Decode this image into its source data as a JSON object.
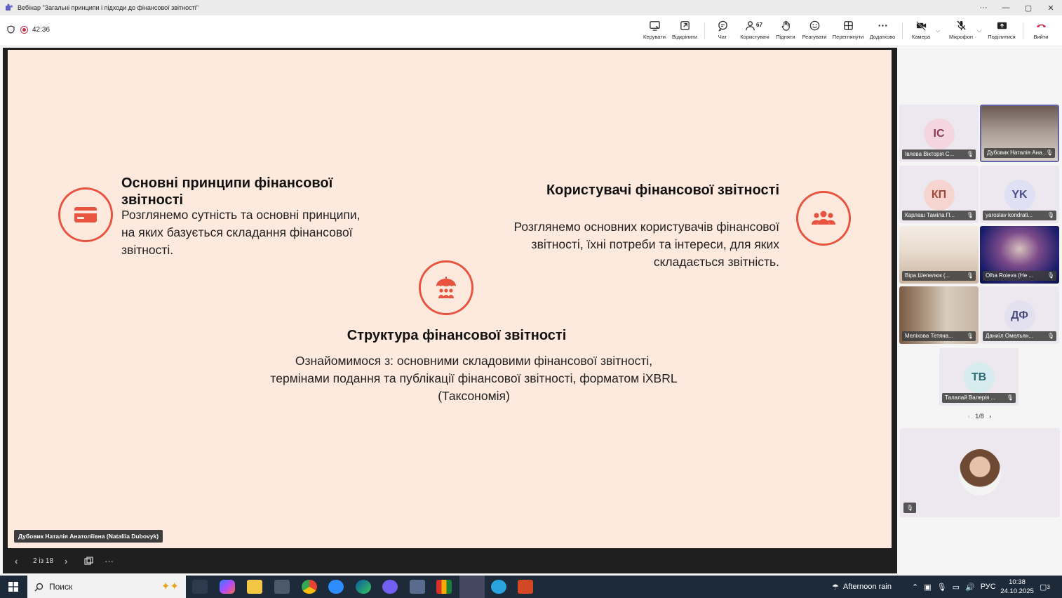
{
  "window": {
    "title": "Вебінар \"Загальні принципи і підходи до фінансової звітності\"",
    "controls": [
      "···",
      "—",
      "▢",
      "✕"
    ]
  },
  "meeting": {
    "timer": "42:36",
    "toolbar": {
      "manage": "Керувати",
      "unpin": "Відкріпити",
      "chat": "Чат",
      "users": "Користувачі",
      "users_count": "67",
      "raise": "Підняти",
      "react": "Реагувати",
      "view": "Переглянути",
      "more": "Додатково",
      "camera": "Камера",
      "mic": "Мікрофон",
      "share": "Поділитися",
      "leave": "Вийти"
    },
    "accent": "#e8543f"
  },
  "slide": {
    "block1": {
      "title": "Основні принципи фінансової звітності",
      "text": "Розглянемо сутність та основні принципи, на яких базується складання фінансової звітності.",
      "icon": "credit-card-icon"
    },
    "block2": {
      "title": "Користувачі фінансової звітності",
      "text": "Розглянемо основних користувачів фінансової звітності, їхні потреби та інтереси, для яких складається звітність.",
      "icon": "users-group-icon"
    },
    "block3": {
      "title": "Структура фінансової звітності",
      "text": "Ознайомимося з: основними складовими фінансової звітності, термінами подання та публікації фінансової звітності, форматом iXBRL (Таксономія)",
      "icon": "umbrella-people-icon"
    },
    "presenter": "Дубовик Наталія Анатоліївна (Nataliia Dubovyk)",
    "page": "2 із 18"
  },
  "participants": [
    {
      "name": "Івлева Вікторія С...",
      "initials": "ІС",
      "color": "#f3d6df",
      "text_color": "#8a3b54"
    },
    {
      "name": "Дубовик Наталія Ана...",
      "initials": "",
      "video": "a"
    },
    {
      "name": "Карлаш Таміла П...",
      "initials": "КП",
      "color": "#f6d5d0",
      "text_color": "#a1463b"
    },
    {
      "name": "yaroslav kondrati...",
      "initials": "YK",
      "color": "#dfe0f3",
      "text_color": "#4a4c8f"
    },
    {
      "name": "Віра Шепелюк (...",
      "initials": "",
      "video": "d"
    },
    {
      "name": "Olha Roieva (Не ...",
      "initials": "",
      "video": "b"
    },
    {
      "name": "Меліхова Тетяна...",
      "initials": "",
      "video": "c"
    },
    {
      "name": "Даниїл Омельян...",
      "initials": "ДФ",
      "color": "#e3e1ef",
      "text_color": "#4a4c7a"
    },
    {
      "name": "Талалай Валерія ...",
      "initials": "ТВ",
      "color": "#d7ecee",
      "text_color": "#2e6b73"
    }
  ],
  "pager": "1/8",
  "taskbar": {
    "search": "Поиск",
    "weather": "Afternoon rain",
    "lang": "РУС",
    "time": "10:38",
    "date": "24.10.2025",
    "notifications": "3"
  }
}
